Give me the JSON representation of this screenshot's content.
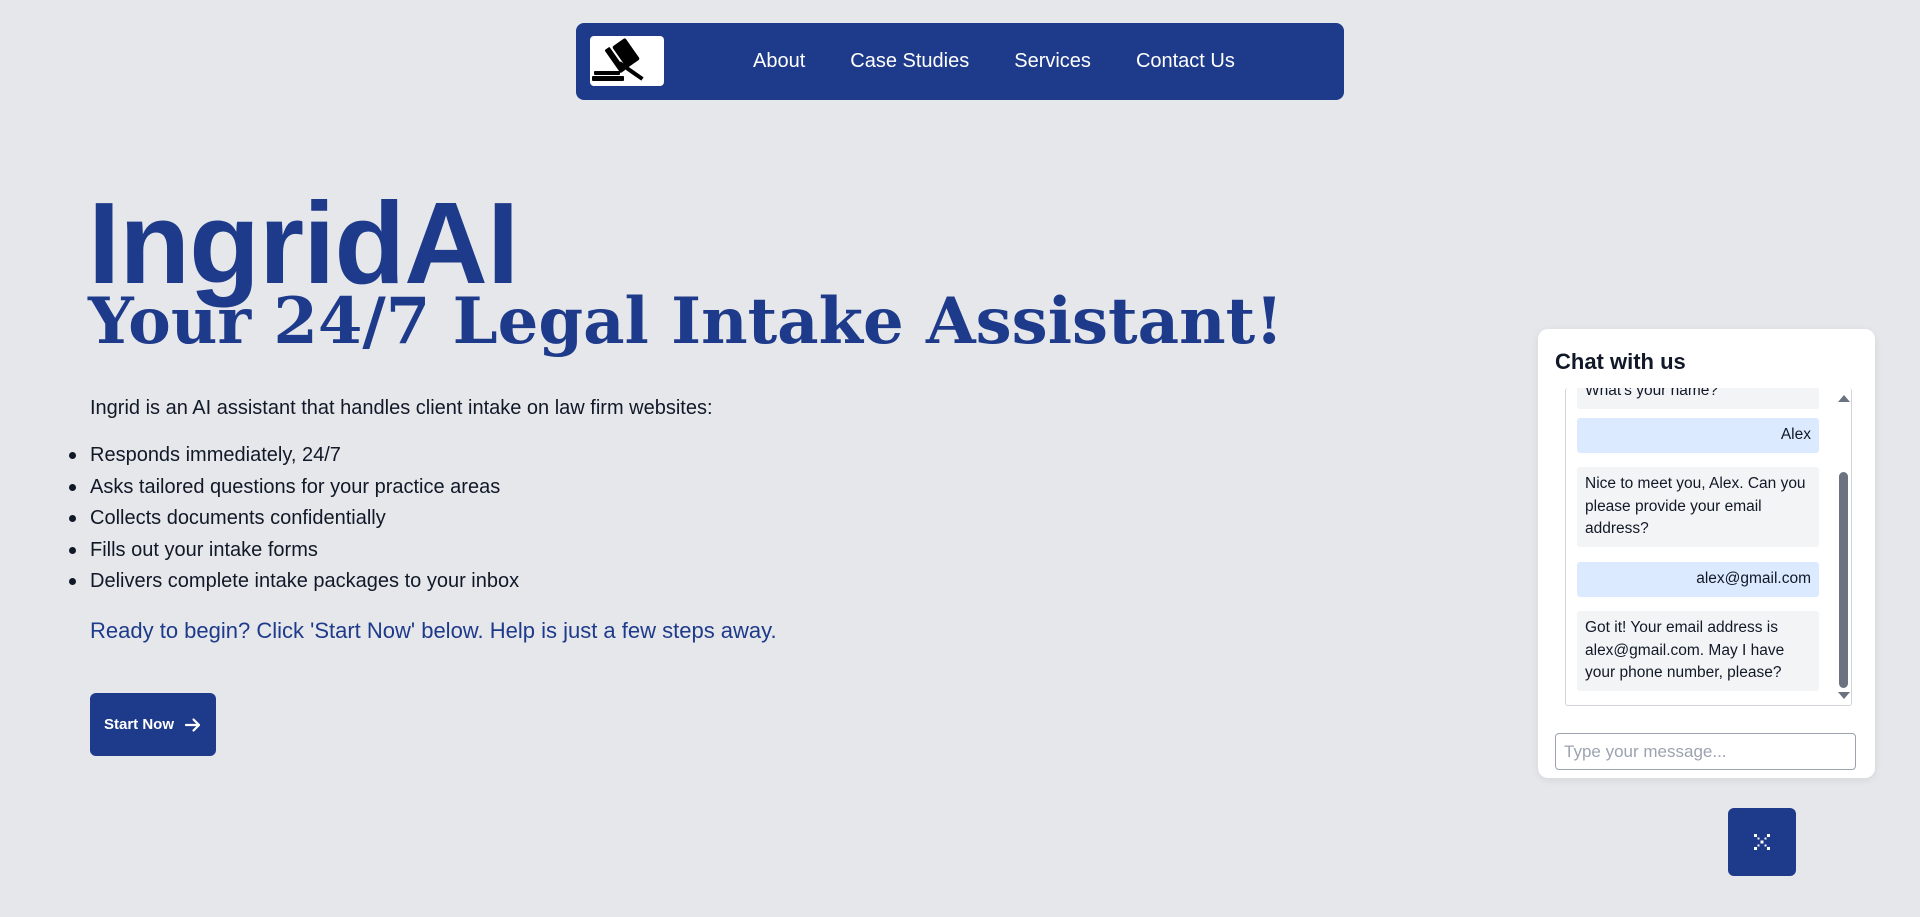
{
  "nav": {
    "logo_icon": "gavel-icon",
    "links": [
      "About",
      "Case Studies",
      "Services",
      "Contact Us"
    ]
  },
  "hero": {
    "title": "IngridAI",
    "subtitle": "Your 24/7 Legal Intake Assistant!",
    "intro": "Ingrid is an AI assistant that handles client intake on law firm websites:",
    "features": [
      "Responds immediately, 24/7",
      "Asks tailored questions for your practice areas",
      "Collects documents confidentially",
      "Fills out your intake forms",
      "Delivers complete intake packages to your inbox"
    ],
    "cta_text": "Ready to begin? Click 'Start Now' below. Help is just a few steps away.",
    "start_button": "Start Now",
    "start_button_icon": "arrow-right-icon"
  },
  "chat": {
    "title": "Chat with us",
    "messages": [
      {
        "role": "bot",
        "text": "What's your name?"
      },
      {
        "role": "user",
        "text": "Alex"
      },
      {
        "role": "bot",
        "text": "Nice to meet you, Alex. Can you please provide your email address?"
      },
      {
        "role": "user",
        "text": "alex@gmail.com"
      },
      {
        "role": "bot",
        "text": "Got it! Your email address is alex@gmail.com. May I have your phone number, please?"
      }
    ],
    "input_placeholder": "Type your message...",
    "toggle_icon": "chat-sparkle-icon"
  },
  "colors": {
    "brand": "#1e3a8a",
    "background": "#e5e7eb",
    "user_bubble": "#dbeafe",
    "bot_bubble": "#f3f4f6"
  }
}
